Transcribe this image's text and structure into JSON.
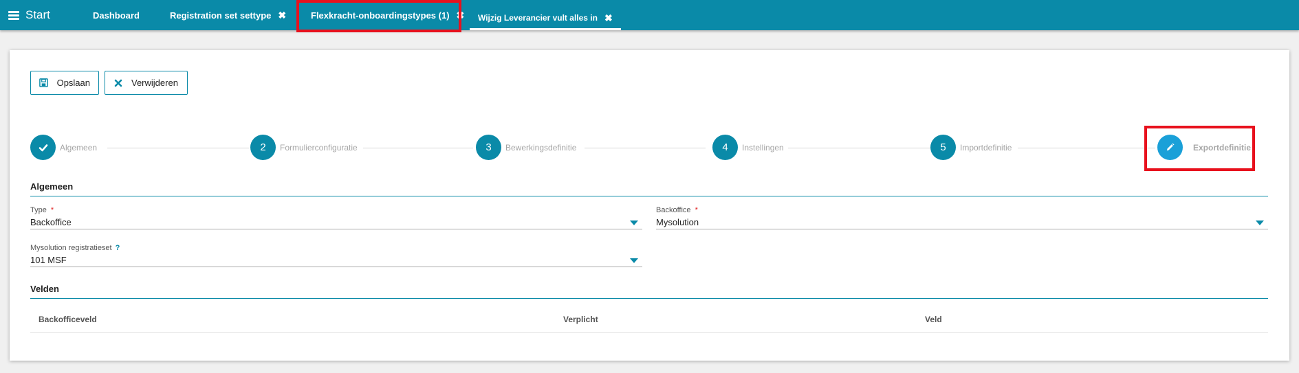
{
  "topbar": {
    "menu_label": "Start",
    "tabs": [
      {
        "label": "Dashboard"
      },
      {
        "label": "Registration set settype"
      },
      {
        "label": "Flexkracht-onboardingstypes (1)"
      },
      {
        "label": "Wijzig Leverancier vult alles in"
      }
    ],
    "close_glyph": "✖",
    "accent_color": "#0a8aa8"
  },
  "toolbar": {
    "save_label": "Opslaan",
    "delete_label": "Verwijderen"
  },
  "stepper": {
    "steps": [
      {
        "number": "",
        "label": "Algemeen",
        "state": "done",
        "icon": "check-icon"
      },
      {
        "number": "2",
        "label": "Formulierconfiguratie",
        "state": "todo"
      },
      {
        "number": "3",
        "label": "Bewerkingsdefinitie",
        "state": "todo"
      },
      {
        "number": "4",
        "label": "Instellingen",
        "state": "todo"
      },
      {
        "number": "5",
        "label": "Importdefinitie",
        "state": "todo"
      },
      {
        "number": "",
        "label": "Exportdefinitie",
        "state": "active",
        "icon": "pencil-icon"
      }
    ]
  },
  "algemeen": {
    "title": "Algemeen",
    "type_label": "Type",
    "type_value": "Backoffice",
    "backoffice_label": "Backoffice",
    "backoffice_value": "Mysolution",
    "registratieset_label": "Mysolution registratieset",
    "registratieset_help": "?",
    "registratieset_value": "101 MSF",
    "required_mark": "*"
  },
  "velden": {
    "title": "Velden",
    "columns": [
      "Backofficeveld",
      "Verplicht",
      "Veld"
    ]
  }
}
